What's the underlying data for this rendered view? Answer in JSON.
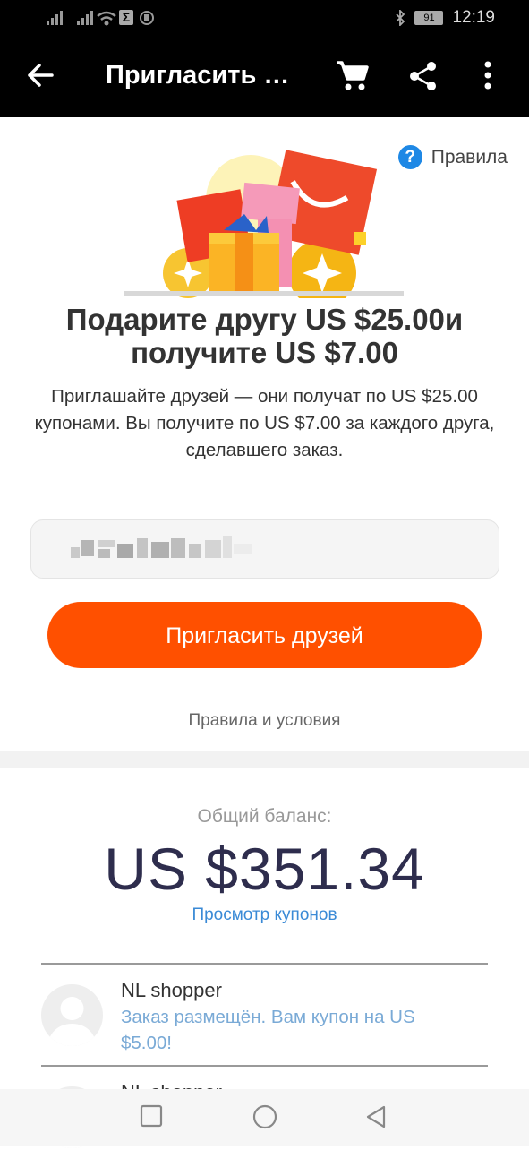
{
  "status_bar": {
    "battery": "91",
    "time": "12:19"
  },
  "app_bar": {
    "title": "Пригласить д..."
  },
  "rules_link": "Правила",
  "headline": {
    "line1": "Подарите другу US $25.00и",
    "line2": "получите US $7.00"
  },
  "description": "Приглашайте друзей — они получат по US $25.00 купонами. Вы получите по US $7.00 за каждого друга, сделавшего заказ.",
  "invite_button": "Пригласить друзей",
  "terms_link": "Правила и условия",
  "balance": {
    "label": "Общий баланс:",
    "value": "US $351.34",
    "view_coupons": "Просмотр купонов"
  },
  "referrals": [
    {
      "name": "NL shopper",
      "message": "Заказ размещён. Вам купон на US $5.00!"
    },
    {
      "name": "NL shopper",
      "message": ""
    }
  ],
  "colors": {
    "accent": "#ff5000",
    "link": "#3a8ad6",
    "help": "#1e88e5",
    "balance": "#2e2d4d"
  },
  "icons": [
    "back-arrow-icon",
    "cart-icon",
    "share-icon",
    "more-vert-icon",
    "help-icon",
    "square-nav-icon",
    "circle-nav-icon",
    "triangle-back-nav-icon"
  ]
}
